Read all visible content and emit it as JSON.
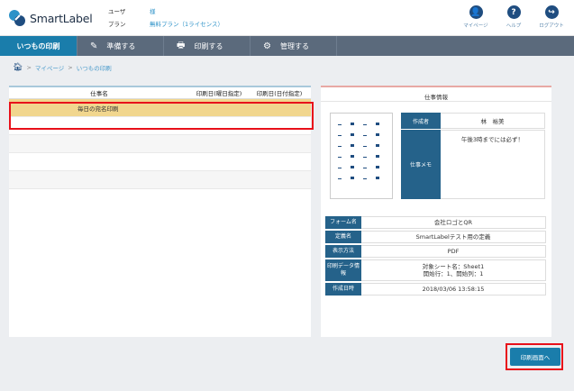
{
  "header": {
    "logo_text": "SmartLabel",
    "user_label": "ユーザ",
    "user_value": "様",
    "plan_label": "プラン",
    "plan_value": "無料プラン（1ライセンス）",
    "icons": [
      {
        "name": "mypage",
        "label": "マイページ",
        "glyph": "👤"
      },
      {
        "name": "help",
        "label": "ヘルプ",
        "glyph": "?"
      },
      {
        "name": "logout",
        "label": "ログアウト",
        "glyph": "↪"
      }
    ]
  },
  "nav": {
    "items": [
      {
        "label": "いつもの印刷",
        "active": true,
        "icon": ""
      },
      {
        "label": "準備する",
        "icon": "✎"
      },
      {
        "label": "印刷する",
        "icon": "🖶"
      },
      {
        "label": "管理する",
        "icon": "⚙"
      }
    ]
  },
  "breadcrumb": {
    "items": [
      "マイページ",
      "いつもの印刷"
    ]
  },
  "job_list": {
    "columns": [
      "仕事名",
      "印刷日(曜日指定)",
      "印刷日(日付指定)"
    ],
    "rows": [
      {
        "name": "毎日の宛名印刷",
        "selected": true
      }
    ]
  },
  "job_info": {
    "title": "仕事情報",
    "creator_label": "作成者",
    "creator_value": "林　裕美",
    "memo_label": "仕事メモ",
    "memo_value": "午後3時までには必ず！",
    "form_label": "フォーム名",
    "form_value": "会社ロゴとQR",
    "def_label": "定義名",
    "def_value": "SmartLabelテスト用の定義",
    "display_label": "表示方法",
    "display_value": "PDF",
    "print_data_label": "印刷データ情報",
    "print_data_line1": "対象シート名：Sheet1",
    "print_data_line2": "開始行：1、開始列：1",
    "created_label": "作成日時",
    "created_value": "2018/03/06 13:58:15"
  },
  "print_button": {
    "label": "印刷画面へ"
  },
  "colors": {
    "accent": "#1a7dab",
    "nav": "#5b6a7c",
    "selected_row": "#f1d68e",
    "highlight": "#e8101a"
  }
}
